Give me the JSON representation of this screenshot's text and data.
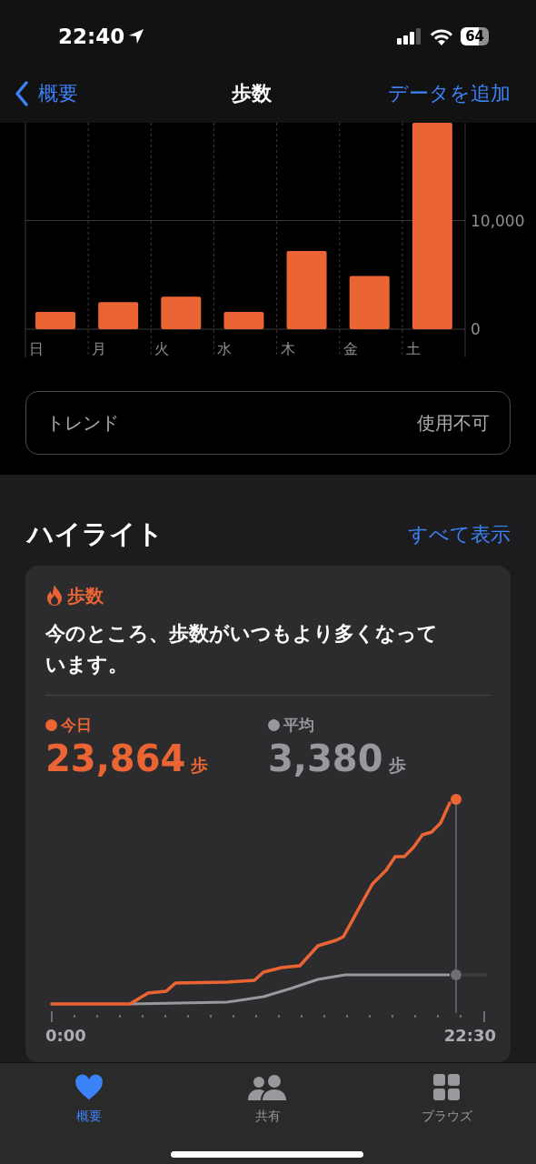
{
  "status_bar": {
    "time": "22:40",
    "battery": "64"
  },
  "nav": {
    "back": "概要",
    "title": "歩数",
    "action": "データを追加"
  },
  "week_chart": {
    "chart_data": {
      "type": "bar",
      "categories": [
        "日",
        "月",
        "火",
        "水",
        "木",
        "金",
        "土"
      ],
      "values": [
        1600,
        2500,
        3000,
        1600,
        7200,
        4900,
        19000
      ],
      "ylim": [
        0,
        19000
      ],
      "yticks": [
        0,
        {
          "value": 10000,
          "label": "10,000"
        }
      ]
    }
  },
  "trend": {
    "label": "トレンド",
    "value": "使用不可"
  },
  "highlights": {
    "title": "ハイライト",
    "see_all": "すべて表示",
    "card": {
      "category": "歩数",
      "message": "今のところ、歩数がいつもより多くなっています。",
      "stats": [
        {
          "label": "今日",
          "value": "23,864",
          "unit": "歩",
          "color": "#eb6534"
        },
        {
          "label": "平均",
          "value": "3,380",
          "unit": "歩",
          "color": "#98989d"
        }
      ],
      "x_start": "0:00",
      "x_end": "22:30"
    }
  },
  "tab_bar": [
    {
      "label": "概要",
      "selected": true
    },
    {
      "label": "共有",
      "selected": false
    },
    {
      "label": "ブラウズ",
      "selected": false
    }
  ]
}
